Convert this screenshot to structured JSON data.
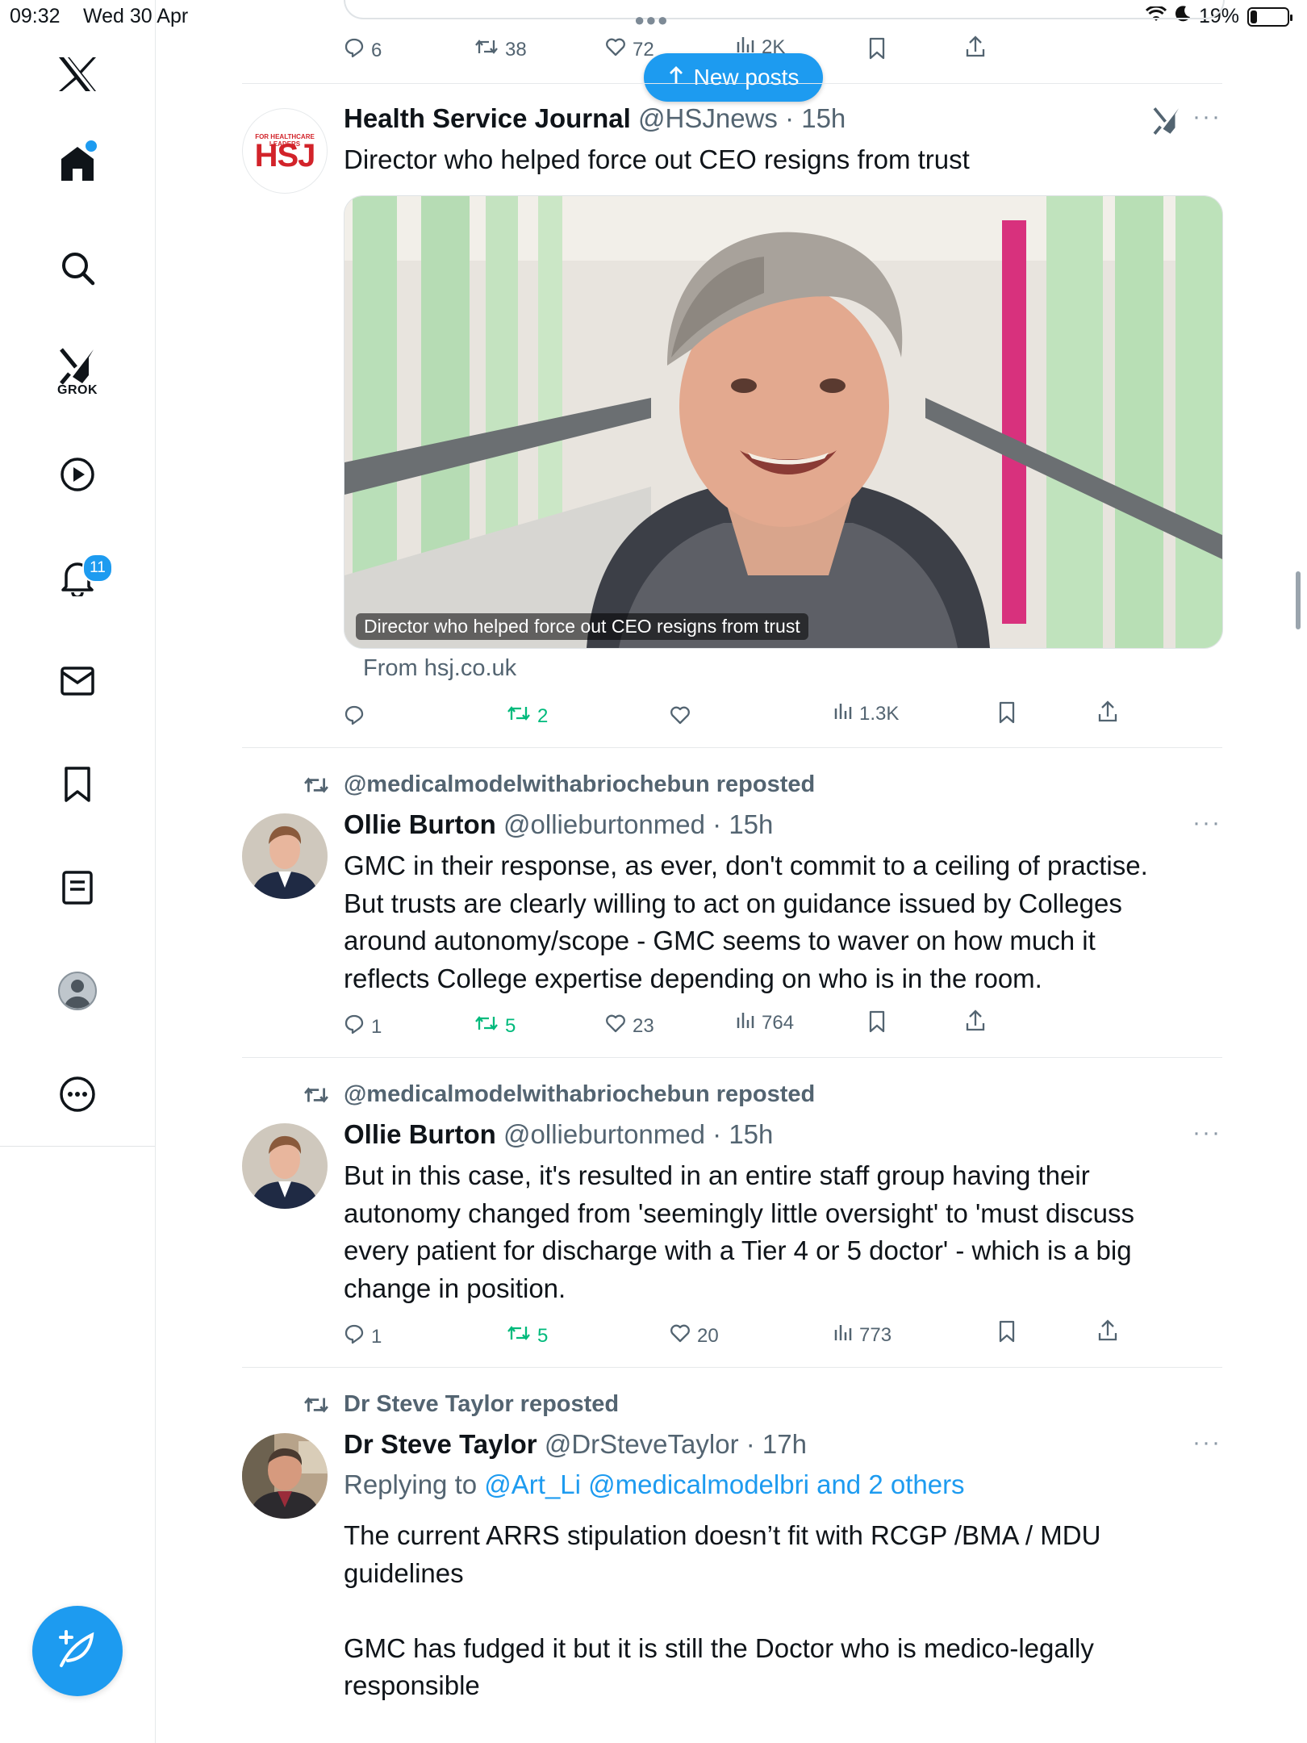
{
  "status_bar": {
    "time": "09:32",
    "date": "Wed 30 Apr",
    "battery": "19%",
    "battery_level": 0.19
  },
  "sidebar": {
    "grok_label": "GROK",
    "notifications_count": "11"
  },
  "new_posts_label": "New posts",
  "top_post": {
    "replies": "6",
    "reposts": "38",
    "likes": "72",
    "views": "2K"
  },
  "posts": [
    {
      "display_name": "Health Service Journal",
      "handle": "@HSJnews",
      "time": "· 15h",
      "avatar_text": "HSJ",
      "avatar_subtext": "FOR HEALTHCARE LEADERS",
      "text": "Director who helped force out CEO resigns from trust",
      "media_caption": "Director who helped force out CEO resigns from trust",
      "link_source": "From hsj.co.uk",
      "reposts": "2",
      "views": "1.3K"
    },
    {
      "repost_by": "@medicalmodelwithabriochebun reposted",
      "display_name": "Ollie Burton",
      "handle": "@ollieburtonmed",
      "time": "· 15h",
      "lines": [
        "GMC in their response, as ever, don't commit to a ceiling of practise.",
        "But trusts are clearly willing to act on guidance issued by Colleges",
        "around autonomy/scope - GMC seems to waver on how much it",
        "reflects College expertise depending on who is in the room."
      ],
      "replies": "1",
      "reposts": "5",
      "likes": "23",
      "views": "764"
    },
    {
      "repost_by": "@medicalmodelwithabriochebun reposted",
      "display_name": "Ollie Burton",
      "handle": "@ollieburtonmed",
      "time": "· 15h",
      "lines": [
        "But in this case, it's resulted in an entire staff group having their",
        "autonomy changed from 'seemingly little oversight' to 'must discuss",
        "every patient for discharge with a Tier 4 or 5 doctor' - which is a big",
        "change in position."
      ],
      "replies": "1",
      "reposts": "5",
      "likes": "20",
      "views": "773"
    },
    {
      "repost_by": "Dr Steve Taylor reposted",
      "display_name": "Dr Steve Taylor",
      "handle": "@DrSteveTaylor",
      "time": "· 17h",
      "replying_prefix": "Replying to",
      "replying_to": "@Art_Li @medicalmodelbri and 2 others",
      "lines": [
        "The current ARRS stipulation doesn’t fit with RCGP /BMA / MDU",
        "guidelines"
      ],
      "lines2": [
        "GMC has fudged it but it is still the Doctor who is medico-legally",
        "responsible"
      ]
    }
  ],
  "colors": {
    "accent": "#1d9bf0",
    "repost_green": "#00ba7c",
    "muted": "#536471",
    "hsj_red": "#d2232a"
  }
}
